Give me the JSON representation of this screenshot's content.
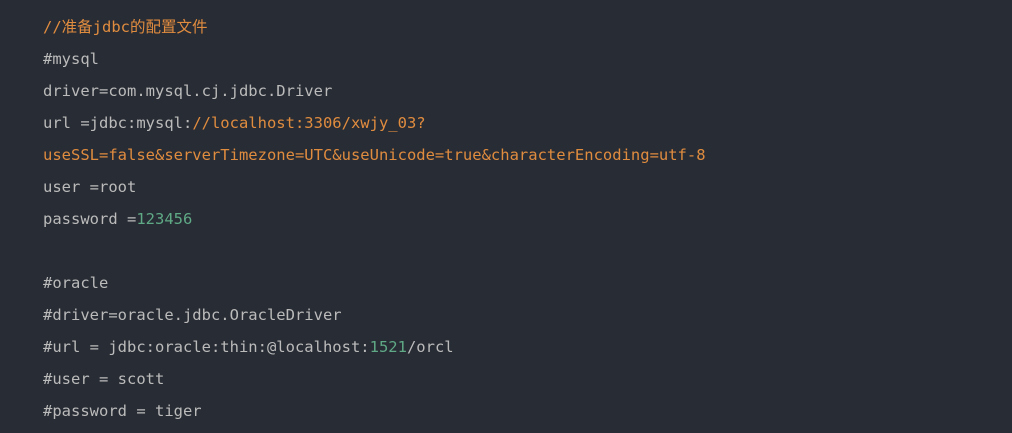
{
  "colors": {
    "background": "#282c34",
    "plain": "#bbbbbb",
    "comment": "#e08c3f",
    "string": "#e08c3f",
    "number": "#5fa986"
  },
  "lines": [
    [
      {
        "t": "//准备jdbc的配置文件",
        "k": "comment"
      }
    ],
    [
      {
        "t": "#mysql",
        "k": "plain"
      }
    ],
    [
      {
        "t": "driver=com.mysql.cj.jdbc.Driver",
        "k": "plain"
      }
    ],
    [
      {
        "t": "url =jdbc:mysql:",
        "k": "plain"
      },
      {
        "t": "//localhost:3306/xwjy_03?",
        "k": "comment"
      }
    ],
    [
      {
        "t": "useSSL=false&serverTimezone=UTC&useUnicode=true&characterEncoding=utf-8",
        "k": "string"
      }
    ],
    [
      {
        "t": "user =root",
        "k": "plain"
      }
    ],
    [
      {
        "t": "password =",
        "k": "plain"
      },
      {
        "t": "123456",
        "k": "number"
      }
    ],
    [],
    [
      {
        "t": "#oracle",
        "k": "plain"
      }
    ],
    [
      {
        "t": "#driver=oracle.jdbc.OracleDriver",
        "k": "plain"
      }
    ],
    [
      {
        "t": "#url = jdbc:oracle:thin:@localhost:",
        "k": "plain"
      },
      {
        "t": "1521",
        "k": "number"
      },
      {
        "t": "/orcl",
        "k": "plain"
      }
    ],
    [
      {
        "t": "#user = scott",
        "k": "plain"
      }
    ],
    [
      {
        "t": "#password = tiger",
        "k": "plain"
      }
    ]
  ]
}
